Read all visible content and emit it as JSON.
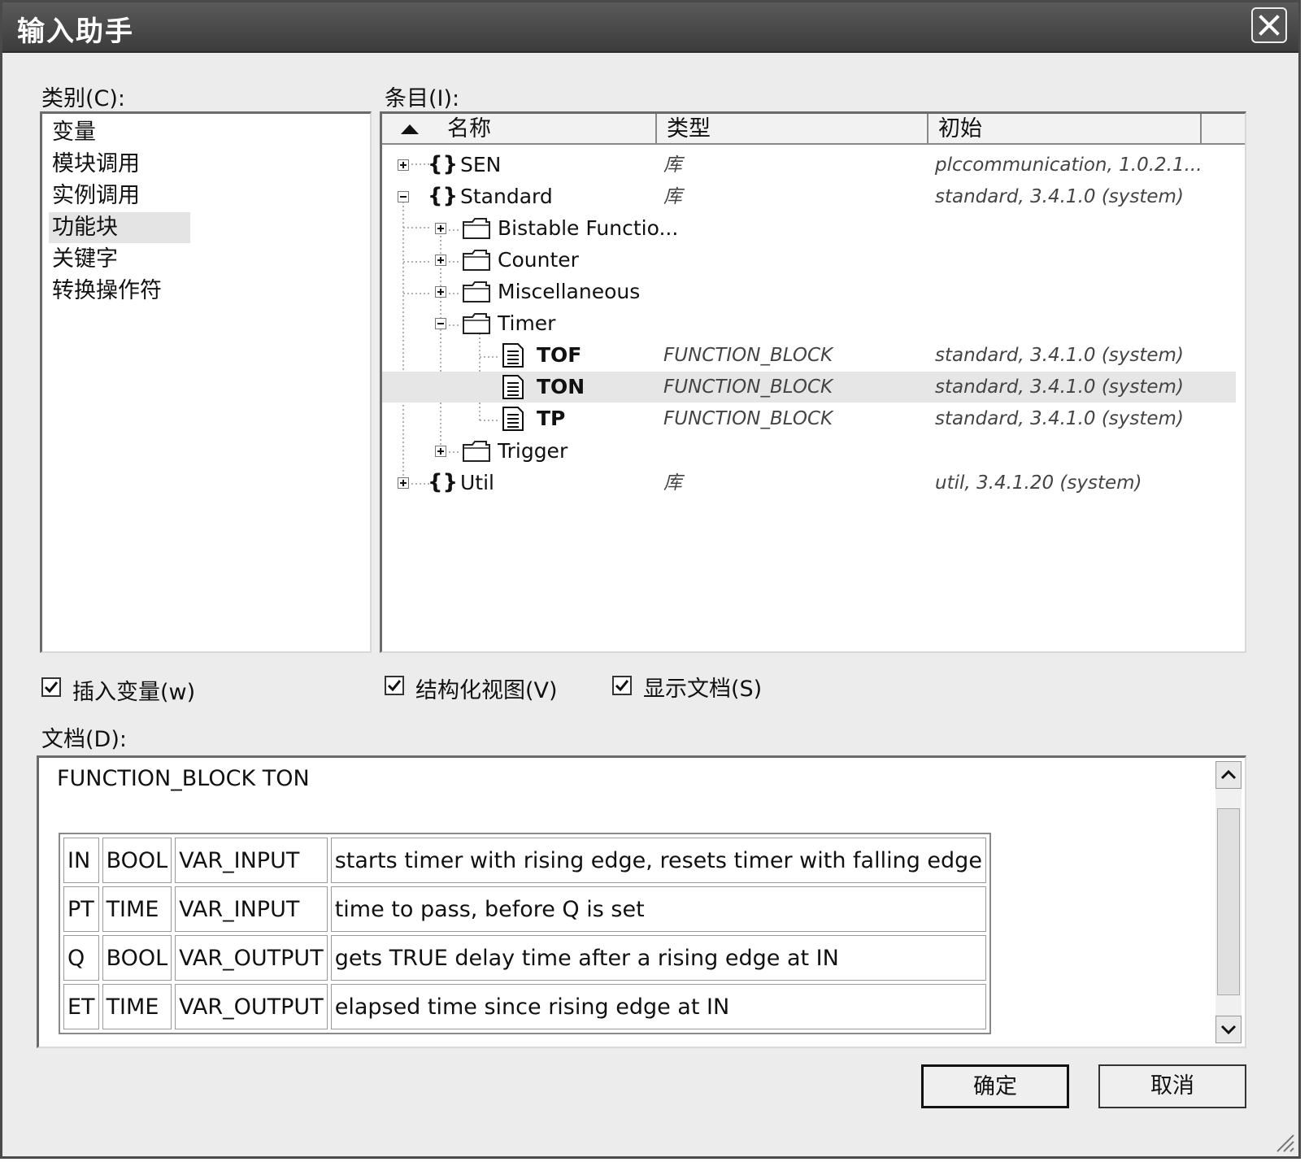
{
  "window": {
    "title": "输入助手"
  },
  "category": {
    "label": "类别(C):",
    "items": [
      "变量",
      "模块调用",
      "实例调用",
      "功能块",
      "关键字",
      "转换操作符"
    ],
    "selected_index": 3
  },
  "items": {
    "label": "条目(I):",
    "columns": [
      "名称",
      "类型",
      "初始"
    ],
    "rows": [
      {
        "name": "SEN",
        "type": "库",
        "init": "plccommunication, 1.0.2.1..."
      },
      {
        "name": "Standard",
        "type": "库",
        "init": "standard, 3.4.1.0 (system)"
      },
      {
        "name": "Bistable Functio...",
        "type": "",
        "init": ""
      },
      {
        "name": "Counter",
        "type": "",
        "init": ""
      },
      {
        "name": "Miscellaneous",
        "type": "",
        "init": ""
      },
      {
        "name": "Timer",
        "type": "",
        "init": ""
      },
      {
        "name": "TOF",
        "type": "FUNCTION_BLOCK",
        "init": "standard, 3.4.1.0 (system)"
      },
      {
        "name": "TON",
        "type": "FUNCTION_BLOCK",
        "init": "standard, 3.4.1.0 (system)"
      },
      {
        "name": "TP",
        "type": "FUNCTION_BLOCK",
        "init": "standard, 3.4.1.0 (system)"
      },
      {
        "name": "Trigger",
        "type": "",
        "init": ""
      },
      {
        "name": "Util",
        "type": "库",
        "init": "util, 3.4.1.20 (system)"
      }
    ]
  },
  "options": {
    "insert_variable": {
      "label": "插入变量(w)",
      "checked": true
    },
    "structured_view": {
      "label": "结构化视图(V)",
      "checked": true
    },
    "show_doc": {
      "label": "显示文档(S)",
      "checked": true
    }
  },
  "doc": {
    "label": "文档(D):",
    "title": "FUNCTION_BLOCK TON",
    "params": [
      [
        "IN",
        "BOOL",
        "VAR_INPUT",
        "starts timer with rising edge, resets timer with falling edge"
      ],
      [
        "PT",
        "TIME",
        "VAR_INPUT",
        "time to pass, before Q is set"
      ],
      [
        "Q",
        "BOOL",
        "VAR_OUTPUT",
        "gets TRUE delay time after a rising edge at IN"
      ],
      [
        "ET",
        "TIME",
        "VAR_OUTPUT",
        "elapsed time since rising edge at IN"
      ]
    ]
  },
  "buttons": {
    "ok": "确定",
    "cancel": "取消"
  }
}
